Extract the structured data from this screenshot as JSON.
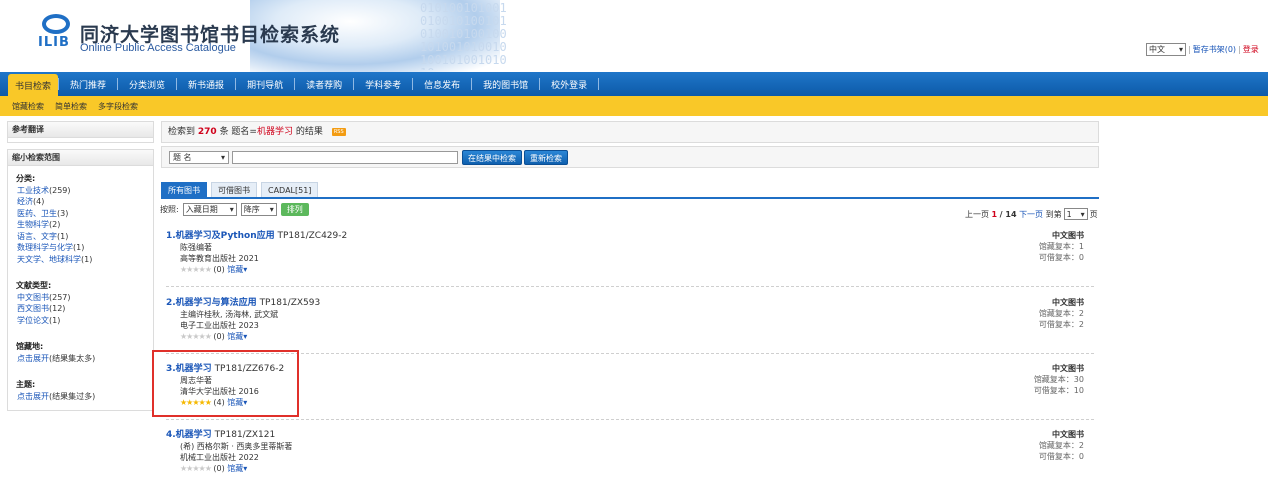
{
  "header": {
    "logo_text": "ILIB",
    "title": "同济大学图书馆书目检索系统",
    "subtitle": "Online Public Access Catalogue",
    "lang": "中文",
    "basket": "暂存书架(0)",
    "login": "登录",
    "globe_digits": "01010010100101001010010101001010010010100101001010010100101010"
  },
  "nav": {
    "items": [
      "书目检索",
      "热门推荐",
      "分类浏览",
      "新书通报",
      "期刊导航",
      "读者荐购",
      "学科参考",
      "信息发布",
      "我的图书馆",
      "校外登录"
    ]
  },
  "subnav": {
    "items": [
      "馆藏检索",
      "简单检索",
      "多字段检索"
    ]
  },
  "sidebar": {
    "ref_title": "参考翻译",
    "narrow_title": "缩小检索范围",
    "groups": [
      {
        "title": "分类:",
        "items": [
          {
            "label": "工业技术",
            "count": "(259)"
          },
          {
            "label": "经济",
            "count": "(4)"
          },
          {
            "label": "医药、卫生",
            "count": "(3)"
          },
          {
            "label": "生物科学",
            "count": "(2)"
          },
          {
            "label": "语言、文字",
            "count": "(1)"
          },
          {
            "label": "数理科学与化学",
            "count": "(1)"
          },
          {
            "label": "天文学、地球科学",
            "count": "(1)"
          }
        ]
      },
      {
        "title": "文献类型:",
        "items": [
          {
            "label": "中文图书",
            "count": "(257)"
          },
          {
            "label": "西文图书",
            "count": "(12)"
          },
          {
            "label": "学位论文",
            "count": "(1)"
          }
        ]
      },
      {
        "title": "馆藏地:",
        "items": [
          {
            "label": "点击展开",
            "count": "(结果集太多)"
          }
        ]
      },
      {
        "title": "主题:",
        "items": [
          {
            "label": "点击展开",
            "count": "(结果集过多)"
          }
        ]
      }
    ]
  },
  "summary": {
    "prefix": "检索到",
    "count": "270",
    "mid": "条 题名=",
    "keyword": "机器学习",
    "suffix": "的结果",
    "rss": "RSS"
  },
  "search": {
    "field": "题 名",
    "query": "",
    "btn_within": "在结果中检索",
    "btn_new": "重新检索"
  },
  "tabs": [
    "所有图书",
    "可借图书",
    "CADAL[51]"
  ],
  "sort": {
    "label": "按照:",
    "field": "入藏日期",
    "order": "降序",
    "btn": "排列"
  },
  "pager": {
    "prev": "上一页",
    "current": "1",
    "total": "/ 14",
    "next": "下一页",
    "goto": "到第",
    "page": "1",
    "unit": "页"
  },
  "records": [
    {
      "title": "1.机器学习及Python应用",
      "call": "TP181/ZC429-2",
      "author": "陈强编著",
      "publisher": "高等教育出版社 2021",
      "rating": 0,
      "rating_text": "(0)",
      "more": "馆藏",
      "type": "中文图书",
      "holdings": "馆藏复本：1",
      "available": "可借复本：0"
    },
    {
      "title": "2.机器学习与算法应用",
      "call": "TP181/ZX593",
      "author": "主编许桂秋, 汤海林, 武文斌",
      "publisher": "电子工业出版社 2023",
      "rating": 0,
      "rating_text": "(0)",
      "more": "馆藏",
      "type": "中文图书",
      "holdings": "馆藏复本：2",
      "available": "可借复本：2"
    },
    {
      "title": "3.机器学习",
      "call": "TP181/ZZ676-2",
      "author": "周志华著",
      "publisher": "清华大学出版社 2016",
      "rating": 5,
      "rating_text": "(4)",
      "more": "馆藏",
      "type": "中文图书",
      "holdings": "馆藏复本：30",
      "available": "可借复本：10"
    },
    {
      "title": "4.机器学习",
      "call": "TP181/ZX121",
      "author": "(希) 西格尔斯 · 西奥多里蒂斯著",
      "publisher": "机械工业出版社 2022",
      "rating": 0,
      "rating_text": "(0)",
      "more": "馆藏",
      "type": "中文图书",
      "holdings": "馆藏复本：2",
      "available": "可借复本：0"
    }
  ]
}
